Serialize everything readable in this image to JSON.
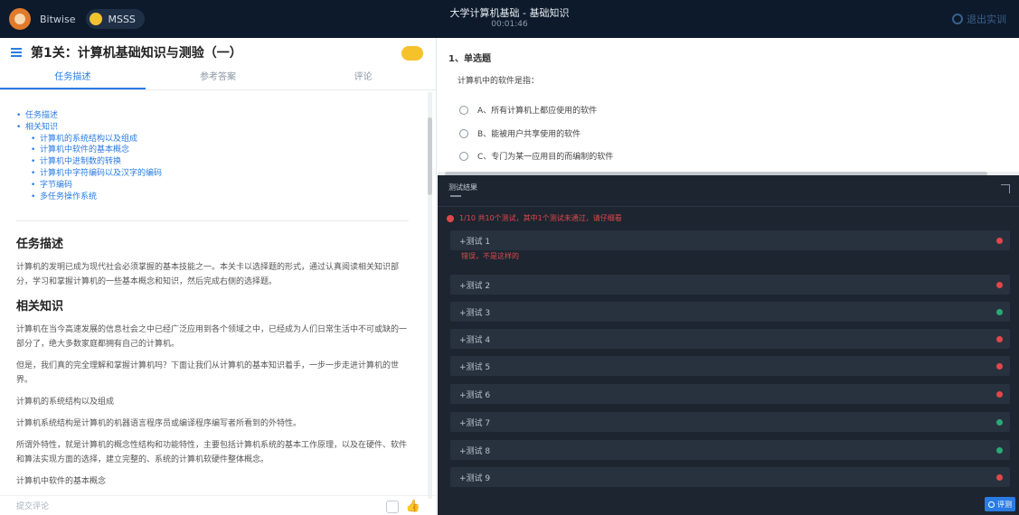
{
  "topbar": {
    "brand": "Bitwise",
    "level": "MSSS",
    "title": "大学计算机基础 - 基础知识",
    "subtitle": "00:01:46",
    "exit_label": "退出实训"
  },
  "left": {
    "title": "第1关：计算机基础知识与测验（一）",
    "tabs": [
      "任务描述",
      "参考答案",
      "评论"
    ],
    "toc": [
      {
        "label": "任务描述",
        "level": 1
      },
      {
        "label": "相关知识",
        "level": 1
      },
      {
        "label": "计算机的系统结构以及组成",
        "level": 2
      },
      {
        "label": "计算机中软件的基本概念",
        "level": 2
      },
      {
        "label": "计算机中进制数的转换",
        "level": 2
      },
      {
        "label": "计算机中字符编码以及汉字的编码",
        "level": 2
      },
      {
        "label": "字节编码",
        "level": 2
      },
      {
        "label": "多任务操作系统",
        "level": 2
      }
    ],
    "section1_title": "任务描述",
    "section1_text": "计算机的发明已成为现代社会必须掌握的基本技能之一。本关卡以选择题的形式，通过认真阅读相关知识部分，学习和掌握计算机的一些基本概念和知识，然后完成右侧的选择题。",
    "section2_title": "相关知识",
    "para1": "计算机在当今高速发展的信息社会之中已经广泛应用到各个领域之中，已经成为人们日常生活中不可或缺的一部分了，绝大多数家庭都拥有自己的计算机。",
    "para2": "但是，我们真的完全理解和掌握计算机吗？下面让我们从计算机的基本知识着手，一步一步走进计算机的世界。",
    "para3": "计算机的系统结构以及组成",
    "para4": "计算机系统结构是计算机的机器语言程序员或编译程序编写者所看到的外特性。",
    "para5": "所谓外特性，就是计算机的概念性结构和功能特性，主要包括计算机系统的基本工作原理，以及在硬件、软件和算法实现方面的选择，建立完整的、系统的计算机软硬件整体概念。",
    "para6": "计算机中软件的基本概念",
    "footer_text": "提交评论"
  },
  "question": {
    "type": "1、单选题",
    "text": "计算机中的软件是指：",
    "options": [
      "A、所有计算机上都应使用的软件",
      "B、能被用户共享使用的软件",
      "C、专门为某一应用目的而编制的软件"
    ]
  },
  "results": {
    "header": "测试结果",
    "error_msg": "1/10 共10个测试，其中1个测试未通过，请仔细看",
    "case_fail_msg": "错误，不是这样的",
    "cases": [
      {
        "label": "+测试 1",
        "status": "fail"
      },
      {
        "label": "+测试 2",
        "status": "fail"
      },
      {
        "label": "+测试 3",
        "status": "pass"
      },
      {
        "label": "+测试 4",
        "status": "fail"
      },
      {
        "label": "+测试 5",
        "status": "fail"
      },
      {
        "label": "+测试 6",
        "status": "fail"
      },
      {
        "label": "+测试 7",
        "status": "pass"
      },
      {
        "label": "+测试 8",
        "status": "pass"
      },
      {
        "label": "+测试 9",
        "status": "fail"
      }
    ],
    "run_label": "评测"
  },
  "colors": {
    "pass": "#2aa876",
    "fail": "#e0474c",
    "accent": "#2a7be4"
  }
}
